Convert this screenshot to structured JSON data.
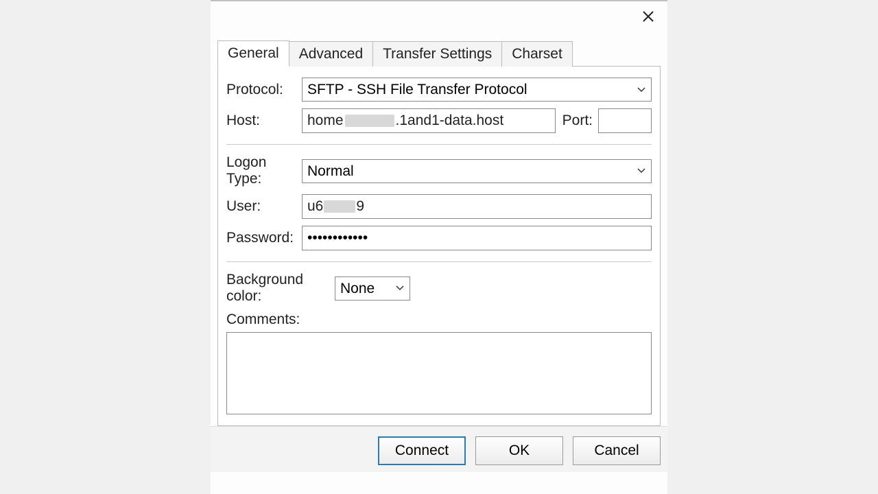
{
  "tabs": {
    "general": "General",
    "advanced": "Advanced",
    "transfer": "Transfer Settings",
    "charset": "Charset"
  },
  "labels": {
    "protocol": "Protocol:",
    "host": "Host:",
    "port": "Port:",
    "logon_type": "Logon Type:",
    "user": "User:",
    "password": "Password:",
    "bgcolor": "Background color:",
    "comments": "Comments:"
  },
  "fields": {
    "protocol_value": "SFTP - SSH File Transfer Protocol",
    "host_prefix": "home",
    "host_suffix": ".1and1-data.host",
    "port_value": "",
    "logon_type_value": "Normal",
    "user_prefix": "u6",
    "user_suffix": "9",
    "password_value": "••••••••••••",
    "bgcolor_value": "None",
    "comments_value": ""
  },
  "buttons": {
    "connect": "Connect",
    "ok": "OK",
    "cancel": "Cancel"
  }
}
